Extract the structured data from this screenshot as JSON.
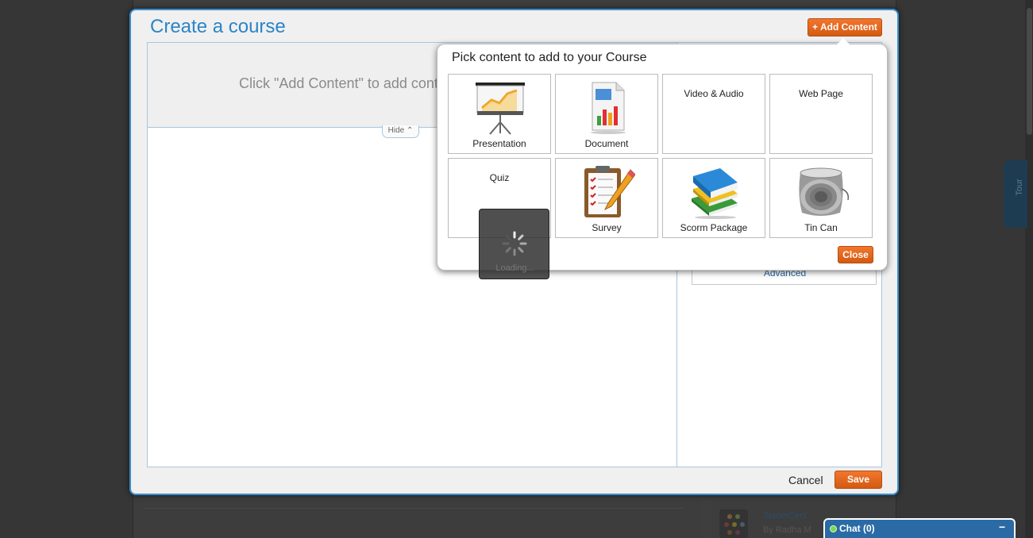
{
  "background": {
    "scorm_item_title": "ScromCer1",
    "scorm_item_author": "By Radha M",
    "tour_label": "Tour"
  },
  "modal": {
    "title": "Create a course",
    "add_content_label": "+ Add Content",
    "editor_hint": "Click \"Add Content\" to add content",
    "hide_label": "Hide ⌃",
    "advanced_label": "Advanced",
    "cancel_label": "Cancel",
    "save_label": "Save"
  },
  "picker": {
    "title": "Pick content to add to your Course",
    "tiles": [
      {
        "label": "Presentation",
        "icon": "presentation-icon"
      },
      {
        "label": "Document",
        "icon": "document-icon"
      },
      {
        "label": "Video & Audio",
        "icon": null
      },
      {
        "label": "Web Page",
        "icon": null
      },
      {
        "label": "Quiz",
        "icon": null
      },
      {
        "label": "Survey",
        "icon": "survey-clipboard-icon"
      },
      {
        "label": "Scorm Package",
        "icon": "books-icon"
      },
      {
        "label": "Tin Can",
        "icon": "tin-can-icon"
      }
    ],
    "close_label": "Close"
  },
  "loading": {
    "text": "Loading..."
  },
  "chat": {
    "label": "Chat  (0)",
    "minimize": "−"
  },
  "colors": {
    "accent_blue": "#2a85c7",
    "button_orange": "#e8671f",
    "chat_blue": "#2a6ba6",
    "online_green": "#7fd64a"
  }
}
